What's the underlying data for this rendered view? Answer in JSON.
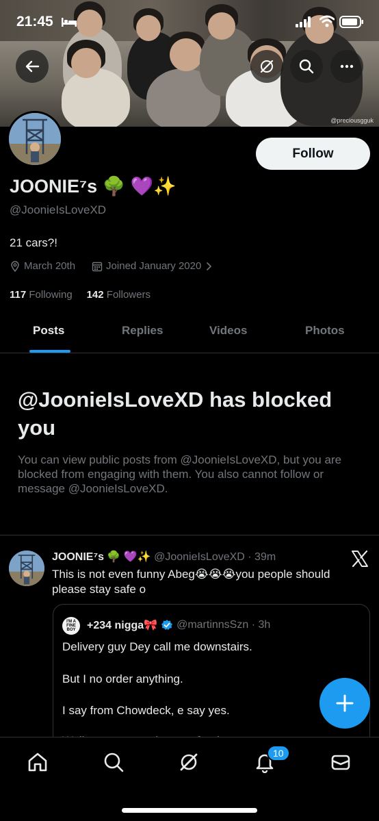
{
  "status_bar": {
    "time": "21:45"
  },
  "banner": {
    "credit": "@preciousgguk"
  },
  "profile": {
    "display_name": "JOONIE⁷s 🌳 💜✨",
    "handle": "@JoonieIsLoveXD",
    "bio": "21 cars?!",
    "birthday": "March 20th",
    "joined": "Joined January 2020",
    "following_count": "117",
    "following_label": "Following",
    "followers_count": "142",
    "followers_label": "Followers",
    "follow_label": "Follow"
  },
  "tabs": [
    {
      "label": "Posts",
      "active": true
    },
    {
      "label": "Replies",
      "active": false
    },
    {
      "label": "Videos",
      "active": false
    },
    {
      "label": "Photos",
      "active": false
    }
  ],
  "blocked": {
    "title": "@JoonieIsLoveXD has blocked you",
    "description": "You can view public posts from @JoonieIsLoveXD, but you are blocked from engaging with them. You also cannot follow or message @JoonieIsLoveXD."
  },
  "tweet": {
    "name": "JOONIE⁷s 🌳 💜✨",
    "handle_time": "@JoonieIsLoveXD · 39m",
    "text": "This is not even funny Abeg😭😭😭you people should please stay safe o",
    "quote": {
      "avatar_text": "I'M A FINE BOY",
      "name": "+234 nigga🎀",
      "handle_time": "@martinnsSzn · 3h",
      "lines": [
        "Delivery guy Dey call me downstairs.",
        "But I no order anything.",
        "I say from Chowdeck, e say yes.",
        "Walkers get to make sure food..."
      ]
    }
  },
  "nav": {
    "notifications_badge": "10"
  },
  "colors": {
    "accent": "#1d9bf0",
    "muted": "#71767b",
    "text": "#e7e9ea",
    "border": "#2f3336"
  }
}
